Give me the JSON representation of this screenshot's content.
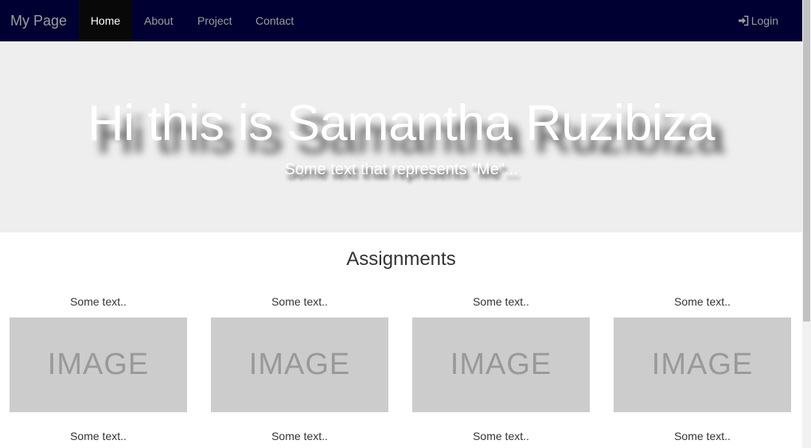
{
  "navbar": {
    "brand": "My Page",
    "items": [
      {
        "label": "Home",
        "active": true
      },
      {
        "label": "About"
      },
      {
        "label": "Project"
      },
      {
        "label": "Contact"
      }
    ],
    "login_label": "Login",
    "login_icon": "log-in-icon",
    "background": "#000033"
  },
  "hero": {
    "title": "Hi this is Samantha Ruzibiza",
    "subtitle": "Some text that represents \"Me\"..."
  },
  "section": {
    "title": "Assignments",
    "cards": [
      {
        "top_text": "Some text..",
        "image_label": "IMAGE",
        "caption": "Some text.."
      },
      {
        "top_text": "Some text..",
        "image_label": "IMAGE",
        "caption": "Some text.."
      },
      {
        "top_text": "Some text..",
        "image_label": "IMAGE",
        "caption": "Some text.."
      },
      {
        "top_text": "Some text..",
        "image_label": "IMAGE",
        "caption": "Some text.."
      }
    ]
  }
}
